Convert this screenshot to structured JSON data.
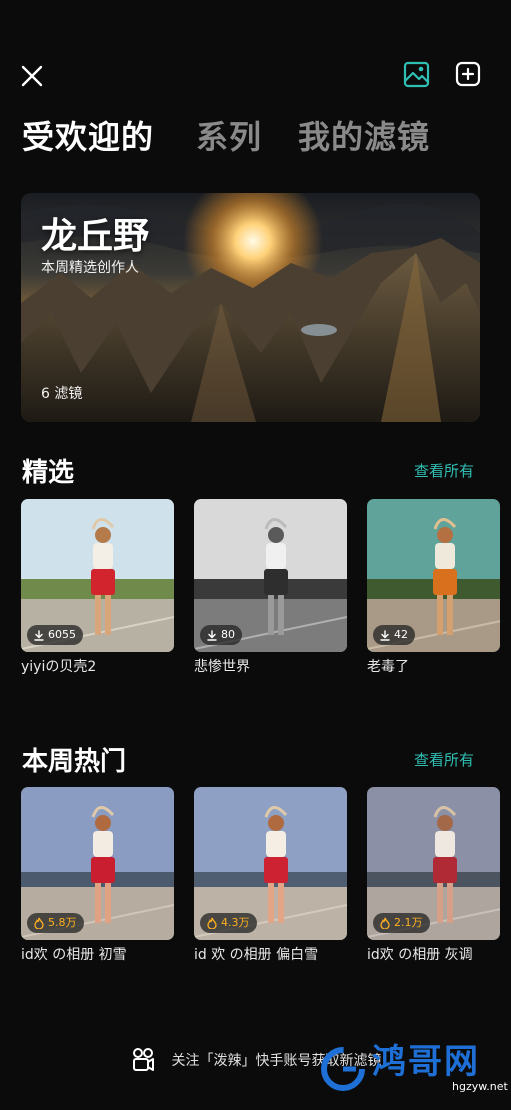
{
  "tabs": [
    "受欢迎的",
    "系列",
    "我的滤镜"
  ],
  "hero": {
    "title": "龙丘野",
    "subtitle": "本周精选创作人",
    "count": "6 滤镜"
  },
  "featured": {
    "title": "精选",
    "see_all": "查看所有",
    "items": [
      {
        "name": "yiyiの贝壳2",
        "stat": "6055"
      },
      {
        "name": "悲惨世界",
        "stat": "80"
      },
      {
        "name": "老毒了",
        "stat": "42"
      }
    ]
  },
  "weekly_hot": {
    "title": "本周热门",
    "see_all": "查看所有",
    "items": [
      {
        "name": "id欢 の相册 初雪",
        "stat": "5.8万"
      },
      {
        "name": "id 欢 の相册 偏白雪",
        "stat": "4.3万"
      },
      {
        "name": "id欢 の相册 灰调",
        "stat": "2.1万"
      }
    ]
  },
  "footer": {
    "text": "关注「泼辣」快手账号获取新滤镜"
  },
  "watermark": {
    "text": "鸿哥网",
    "sub": "hgzyw.net"
  },
  "colors": {
    "accent": "#2fbfb3",
    "hot": "#ffb020",
    "background": "#0b0b0b"
  },
  "icons": [
    "close-icon",
    "gallery-icon",
    "add-filter-icon",
    "download-icon",
    "flame-icon",
    "kuaishou-icon"
  ]
}
